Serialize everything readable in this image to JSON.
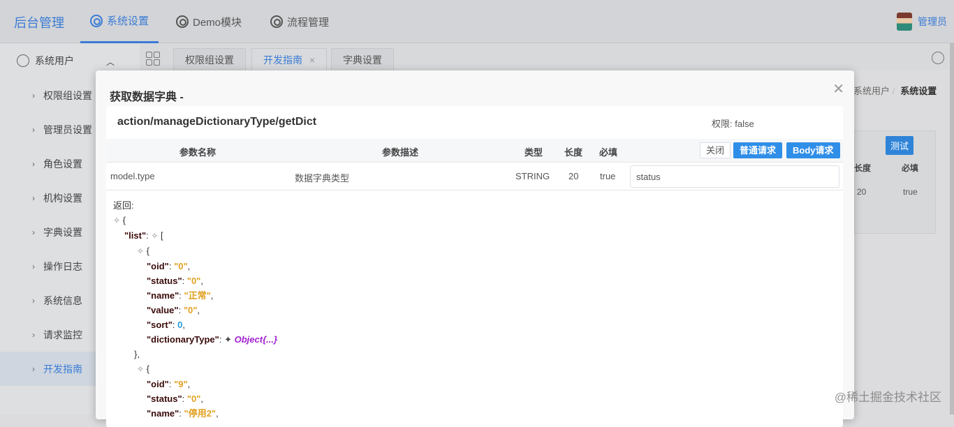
{
  "header": {
    "logo": "后台管理",
    "nav": [
      {
        "label": "系统设置",
        "active": true
      },
      {
        "label": "Demo模块"
      },
      {
        "label": "流程管理"
      }
    ],
    "user": "管理员"
  },
  "sidebar": {
    "group": "系统用户",
    "items": [
      "权限组设置",
      "管理员设置",
      "角色设置",
      "机构设置",
      "字典设置",
      "操作日志",
      "系统信息",
      "请求监控",
      "开发指南"
    ],
    "active": "开发指南"
  },
  "tabs": [
    "权限组设置",
    "开发指南",
    "字典设置"
  ],
  "background": {
    "breadcrumb": [
      "系统用户",
      "系统设置"
    ],
    "test_button": "测试",
    "headers": [
      "长度",
      "必填"
    ],
    "row": [
      "20",
      "true"
    ]
  },
  "modal": {
    "title": "获取数据字典 -",
    "api": "action/manageDictionaryType/getDict",
    "permission": "权限: false",
    "columns": [
      "参数名称",
      "参数描述",
      "类型",
      "长度",
      "必填"
    ],
    "buttons": {
      "close": "关闭",
      "normal": "普通请求",
      "body": "Body请求"
    },
    "param": {
      "name": "model.type",
      "desc": "数据字典类型",
      "type": "STRING",
      "length": "20",
      "required": "true",
      "value": "status"
    },
    "return_label": "返回:",
    "json": {
      "list_key": "\"list\"",
      "item1": {
        "oid": "\"0\"",
        "status": "\"0\"",
        "name": "\"正常\"",
        "value": "\"0\"",
        "sort": "0",
        "dictionaryType": "Object{...}"
      },
      "item2": {
        "oid": "\"9\"",
        "status": "\"0\"",
        "name": "\"停用2\""
      }
    }
  },
  "watermark": "@稀土掘金技术社区",
  "colors": {
    "accent": "#3a7bd5",
    "primary_button": "#2f8ee8"
  }
}
